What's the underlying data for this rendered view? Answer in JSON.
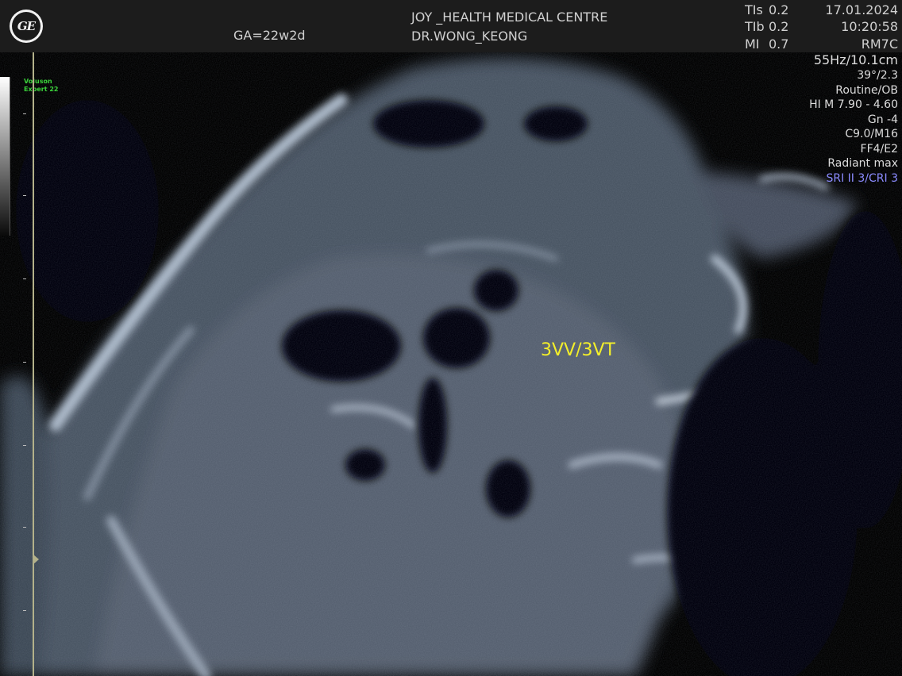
{
  "header": {
    "logo_text": "GE",
    "gestational_age": "GA=22w2d",
    "centre": "JOY _HEALTH MEDICAL CENTRE",
    "doctor": "DR.WONG_KEONG",
    "indices": [
      {
        "label": "TIs",
        "value": "0.2"
      },
      {
        "label": "TIb",
        "value": "0.2"
      },
      {
        "label": "MI",
        "value": "0.7"
      }
    ],
    "date": "17.01.2024",
    "time": "10:20:58",
    "probe": "RM7C"
  },
  "params": {
    "frame_depth": "55Hz/10.1cm",
    "angle": "39°/2.3",
    "preset": "Routine/OB",
    "harmonic": "HI M  7.90 - 4.60",
    "gain": "Gn  -4",
    "settings": "C9.0/M16",
    "filter": "FF4/E2",
    "mode": "Radiant max",
    "sri": "SRI II 3/CRI 3"
  },
  "sidebar": {
    "brand_line1": "Voluson",
    "brand_line2": "Expert 22"
  },
  "annotation": {
    "text": "3VV/3VT",
    "color": "#f3ef2a"
  },
  "colors": {
    "header_bg": "#1c1c1c",
    "ruler": "#b3b18a",
    "sri_text": "#8b8bff",
    "brand": "#3bd43b"
  }
}
